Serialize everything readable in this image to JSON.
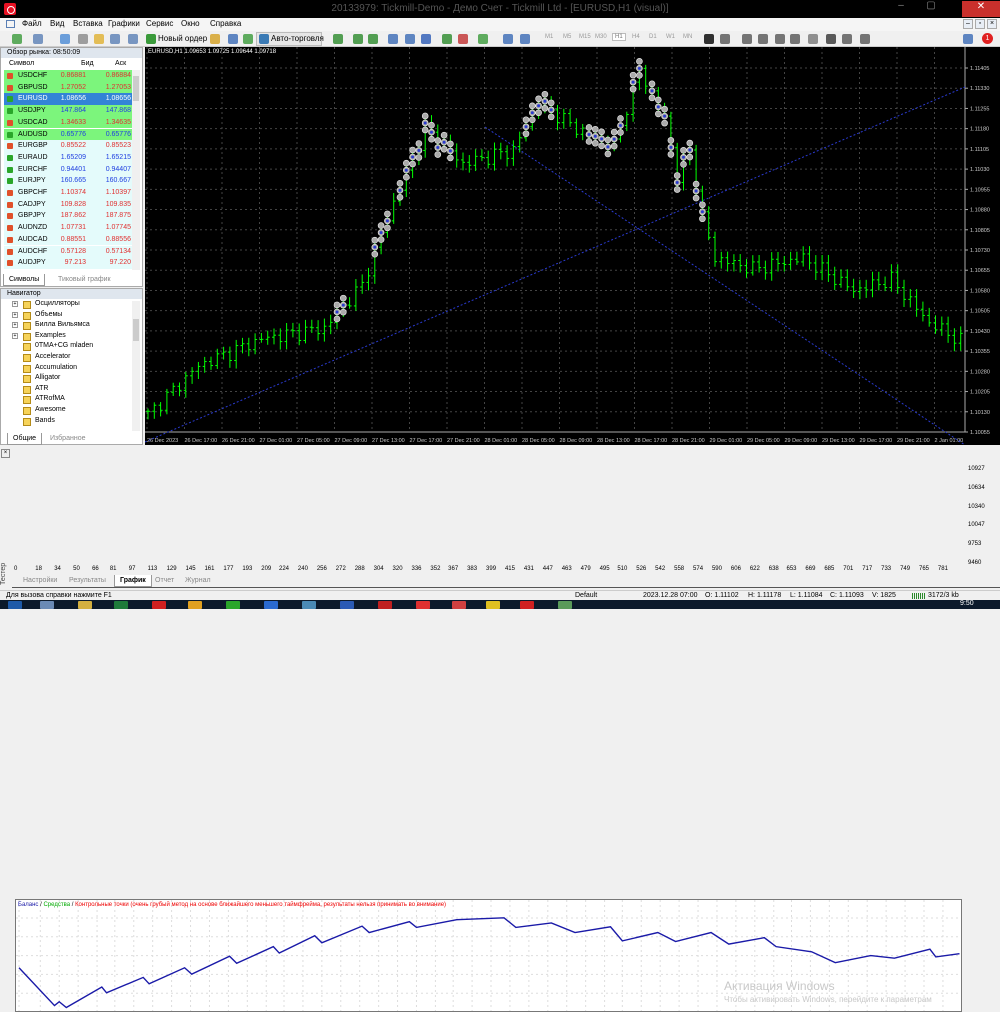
{
  "window": {
    "title": "20133979: Tickmill-Demo - Демо Счет - Tickmill Ltd - [EURUSD,H1 (visual)]",
    "minimize": "‒",
    "maximize": "▢",
    "close": "✕"
  },
  "menu": [
    "Файл",
    "Вид",
    "Вставка",
    "Графики",
    "Сервис",
    "Окно",
    "Справка"
  ],
  "toolbar": {
    "new_order": "Новый ордер",
    "autotrading": "Авто-торговля",
    "timeframes": [
      "M1",
      "M5",
      "M15",
      "M30",
      "H1",
      "H4",
      "D1",
      "W1",
      "MN"
    ],
    "active_timeframe": "H1",
    "notification_count": "1"
  },
  "market_watch": {
    "title": "Обзор рынка: 08:50:09",
    "columns": [
      "Символ",
      "Бид",
      "Аск"
    ],
    "rows": [
      {
        "symbol": "USDCHF",
        "bid": "0.86881",
        "ask": "0.86884",
        "dir": "down",
        "hl": true
      },
      {
        "symbol": "GBPUSD",
        "bid": "1.27052",
        "ask": "1.27053",
        "dir": "down",
        "hl": true
      },
      {
        "symbol": "EURUSD",
        "bid": "1.08656",
        "ask": "1.08656",
        "dir": "up",
        "sel": true
      },
      {
        "symbol": "USDJPY",
        "bid": "147.864",
        "ask": "147.868",
        "dir": "up",
        "hl": true
      },
      {
        "symbol": "USDCAD",
        "bid": "1.34633",
        "ask": "1.34635",
        "dir": "down",
        "hl": true
      },
      {
        "symbol": "AUDUSD",
        "bid": "0.65776",
        "ask": "0.65776",
        "dir": "up",
        "hl": true
      },
      {
        "symbol": "EURGBP",
        "bid": "0.85522",
        "ask": "0.85523",
        "dir": "down"
      },
      {
        "symbol": "EURAUD",
        "bid": "1.65209",
        "ask": "1.65215",
        "dir": "up"
      },
      {
        "symbol": "EURCHF",
        "bid": "0.94401",
        "ask": "0.94407",
        "dir": "up"
      },
      {
        "symbol": "EURJPY",
        "bid": "160.665",
        "ask": "160.667",
        "dir": "up"
      },
      {
        "symbol": "GBPCHF",
        "bid": "1.10374",
        "ask": "1.10397",
        "dir": "down"
      },
      {
        "symbol": "CADJPY",
        "bid": "109.828",
        "ask": "109.835",
        "dir": "down"
      },
      {
        "symbol": "GBPJPY",
        "bid": "187.862",
        "ask": "187.875",
        "dir": "down"
      },
      {
        "symbol": "AUDNZD",
        "bid": "1.07731",
        "ask": "1.07745",
        "dir": "down"
      },
      {
        "symbol": "AUDCAD",
        "bid": "0.88551",
        "ask": "0.88556",
        "dir": "down"
      },
      {
        "symbol": "AUDCHF",
        "bid": "0.57128",
        "ask": "0.57134",
        "dir": "down"
      },
      {
        "symbol": "AUDJPY",
        "bid": "97.213",
        "ask": "97.220",
        "dir": "down"
      }
    ],
    "tabs": [
      "Символы",
      "Тиковый график"
    ]
  },
  "navigator": {
    "title": "Навигатор",
    "items": [
      "Осцилляторы",
      "Объемы",
      "Билла Вильямса",
      "Examples",
      "0TMA+CG mladen",
      "Accelerator",
      "Accumulation",
      "Alligator",
      "ATR",
      "ATRofMA",
      "Awesome",
      "Bands"
    ],
    "tabs": [
      "Общие",
      "Избранное"
    ]
  },
  "chart": {
    "header": "EURUSD,H1  1.09653 1.09725 1.09644 1.09718",
    "price_labels": [
      "1.11405",
      "1.11330",
      "1.11255",
      "1.11180",
      "1.11105",
      "1.11030",
      "1.10955",
      "1.10880",
      "1.10805",
      "1.10730",
      "1.10655",
      "1.10580",
      "1.10505",
      "1.10430",
      "1.10355",
      "1.10280",
      "1.10205",
      "1.10130",
      "1.10055"
    ],
    "time_labels": [
      "26 Dec 2023",
      "26 Dec 17:00",
      "26 Dec 21:00",
      "27 Dec 01:00",
      "27 Dec 05:00",
      "27 Dec 09:00",
      "27 Dec 13:00",
      "27 Dec 17:00",
      "27 Dec 21:00",
      "28 Dec 01:00",
      "28 Dec 05:00",
      "28 Dec 09:00",
      "28 Dec 13:00",
      "28 Dec 17:00",
      "28 Dec 21:00",
      "29 Dec 01:00",
      "29 Dec 05:00",
      "29 Dec 09:00",
      "29 Dec 13:00",
      "29 Dec 17:00",
      "29 Dec 21:00",
      "2 Jan 01:00"
    ],
    "price_range": [
      1.10055,
      1.11405
    ],
    "close_keypoints": [
      [
        0,
        1.1012
      ],
      [
        8,
        1.103
      ],
      [
        18,
        1.104
      ],
      [
        28,
        1.1044
      ],
      [
        34,
        1.106
      ],
      [
        38,
        1.1085
      ],
      [
        44,
        1.1118
      ],
      [
        50,
        1.1105
      ],
      [
        58,
        1.111
      ],
      [
        62,
        1.1128
      ],
      [
        68,
        1.1118
      ],
      [
        74,
        1.1112
      ],
      [
        78,
        1.114
      ],
      [
        82,
        1.1122
      ],
      [
        84,
        1.11
      ],
      [
        86,
        1.111
      ],
      [
        88,
        1.1085
      ],
      [
        90,
        1.107
      ],
      [
        96,
        1.1066
      ],
      [
        104,
        1.107
      ],
      [
        112,
        1.1058
      ],
      [
        118,
        1.1062
      ],
      [
        124,
        1.1046
      ],
      [
        130,
        1.1038
      ]
    ]
  },
  "tester": {
    "legend_balance": "Баланс",
    "legend_equity": "Средства",
    "legend_note": "Контрольные точки (очень грубый метод на основе ближайшего меньшего таймфрейма, результаты нельзя принимать во внимание)",
    "y_labels": [
      "10927",
      "10634",
      "10340",
      "10047",
      "9753",
      "9460"
    ],
    "x_labels": [
      "0",
      "18",
      "34",
      "50",
      "66",
      "81",
      "97",
      "113",
      "129",
      "145",
      "161",
      "177",
      "193",
      "209",
      "224",
      "240",
      "256",
      "272",
      "288",
      "304",
      "320",
      "336",
      "352",
      "367",
      "383",
      "399",
      "415",
      "431",
      "447",
      "463",
      "479",
      "495",
      "510",
      "526",
      "542",
      "558",
      "574",
      "590",
      "606",
      "622",
      "638",
      "653",
      "669",
      "685",
      "701",
      "717",
      "733",
      "749",
      "765",
      "781"
    ],
    "balance_keypoints": [
      [
        0,
        10150
      ],
      [
        30,
        9560
      ],
      [
        34,
        9620
      ],
      [
        40,
        9530
      ],
      [
        70,
        9850
      ],
      [
        74,
        9760
      ],
      [
        105,
        10000
      ],
      [
        110,
        9900
      ],
      [
        140,
        10150
      ],
      [
        146,
        10050
      ],
      [
        178,
        10330
      ],
      [
        184,
        10220
      ],
      [
        215,
        10480
      ],
      [
        220,
        10380
      ],
      [
        250,
        10650
      ],
      [
        256,
        10540
      ],
      [
        290,
        10800
      ],
      [
        296,
        10700
      ],
      [
        330,
        10870
      ],
      [
        336,
        10780
      ],
      [
        370,
        10900
      ],
      [
        410,
        10930
      ],
      [
        420,
        10780
      ],
      [
        450,
        10850
      ],
      [
        470,
        10700
      ],
      [
        500,
        10790
      ],
      [
        510,
        10570
      ],
      [
        540,
        10700
      ],
      [
        555,
        10560
      ],
      [
        585,
        10700
      ],
      [
        600,
        10520
      ],
      [
        630,
        10620
      ],
      [
        640,
        10480
      ],
      [
        670,
        10400
      ],
      [
        690,
        10230
      ],
      [
        720,
        10340
      ],
      [
        740,
        10300
      ],
      [
        770,
        10440
      ],
      [
        775,
        10320
      ],
      [
        795,
        10370
      ]
    ],
    "side_label": "Тестер",
    "tabs": [
      "Настройки",
      "Результаты",
      "График",
      "Отчет",
      "Журнал"
    ],
    "active_tab": "График"
  },
  "watermark": {
    "title": "Активация Windows",
    "text": "Чтобы активировать Windows, перейдите к параметрам"
  },
  "status": {
    "help": "Для вызова справки нажмите F1",
    "profile": "Default",
    "datetime": "2023.12.28 07:00",
    "open": "O: 1.11102",
    "high": "H: 1.11178",
    "low": "L: 1.11084",
    "close": "C: 1.11093",
    "volume": "V: 1825",
    "traffic": "3172/3 kb"
  },
  "taskbar": {
    "clock": "9:50"
  },
  "colors": {
    "up": "#00ff00",
    "grid": "#555",
    "accent": "#0078d7",
    "balance": "#1a1aa8"
  }
}
